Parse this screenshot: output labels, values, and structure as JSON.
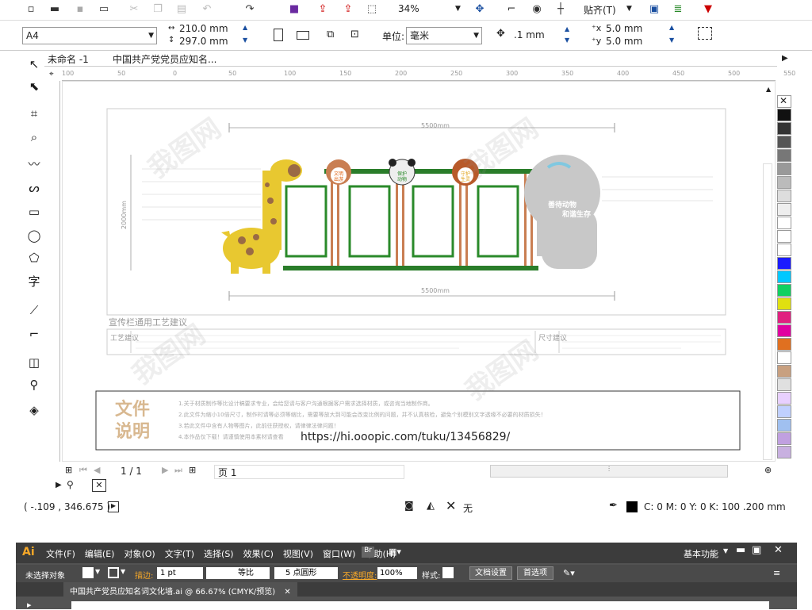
{
  "top_toolbar": {
    "zoom": "34%",
    "snap_label": "贴齐(T)"
  },
  "property_bar": {
    "page_size": "A4",
    "width": "210.0 mm",
    "height": "297.0 mm",
    "units_label": "单位:",
    "units_value": "毫米",
    "nudge": ".1 mm",
    "dup_x": "5.0 mm",
    "dup_y": "5.0 mm"
  },
  "doc_tabs": [
    "未命名 -1",
    "中国共产党党员应知名..."
  ],
  "ruler_ticks": [
    "100",
    "50",
    "0",
    "50",
    "100",
    "150",
    "200",
    "250",
    "300",
    "350",
    "400",
    "450",
    "500",
    "550"
  ],
  "design": {
    "dim_top": "5500mm",
    "dim_bottom": "5500mm",
    "dim_left": "2000mm",
    "giraffe_sign": "",
    "sign_deer": [
      "文明",
      "出游"
    ],
    "sign_panda": [
      "保护",
      "动物"
    ],
    "sign_lion": [
      "守护",
      "生灵"
    ],
    "elephant_text1": "善待动物",
    "elephant_text2": "和谐生存",
    "craft_title": "宣传栏通用工艺建议",
    "craft_left_label": "工艺建议",
    "craft_right_label": "尺寸建议",
    "file_label_1": "文件",
    "file_label_2": "说明",
    "file_notes": [
      "1.关于材质制作等比设计稿要求专业，会给您请与客户沟通根据客户需求选择材质，或咨询当地制作商。",
      "2.此文件为缩小10倍尺寸，制作时请等必须等缩比，需要等放大到可能会改变比例的问题，并不认真核检，避免个别模别文字透缘不必要的材质损失！",
      "3.若此文件中含有人物等图片，此前往获授权，请律律法律问题！",
      "4.本作品仅下载！请谨慎使用本素材请查看"
    ],
    "url": "https://hi.ooopic.com/tuku/13456829/"
  },
  "page_nav": {
    "counter": "1 / 1",
    "page_tab": "页 1"
  },
  "status": {
    "coords": "( -.109 , 346.675 )",
    "fill_label": "无",
    "color_info": "C: 0 M: 0 Y: 0 K: 100  .200 mm"
  },
  "illustrator": {
    "logo": "Ai",
    "menu": [
      "文件(F)",
      "编辑(E)",
      "对象(O)",
      "文字(T)",
      "选择(S)",
      "效果(C)",
      "视图(V)",
      "窗口(W)",
      "帮助(H)"
    ],
    "workspace": "基本功能",
    "no_selection": "未选择对象",
    "stroke_label": "描边:",
    "stroke_value": "1 pt",
    "line_label": "等比",
    "brush_label": "5 点圆形",
    "opacity_label": "不透明度:",
    "opacity_value": "100%",
    "style_label": "样式:",
    "doc_settings": "文档设置",
    "prefs": "首选项",
    "doc_tab": "中国共产党员应知名词文化墙.ai @ 66.67% (CMYK/预览)"
  },
  "palette_colors": [
    "#111111",
    "#333333",
    "#555555",
    "#777777",
    "#999999",
    "#bbbbbb",
    "#dddddd",
    "#eeeeee",
    "#ffffff",
    "#ffffff",
    "#ffffff",
    "#1a1aff",
    "#00c8ff",
    "#10d060",
    "#e0e010",
    "#e02080",
    "#e000a0",
    "#e07020",
    "#ffffff",
    "#c8a080",
    "#e0e0e0",
    "#e8d0ff",
    "#c0d0ff",
    "#a0c0f0",
    "#c0a0e0",
    "#c8b0e0"
  ],
  "watermark": "我图网"
}
